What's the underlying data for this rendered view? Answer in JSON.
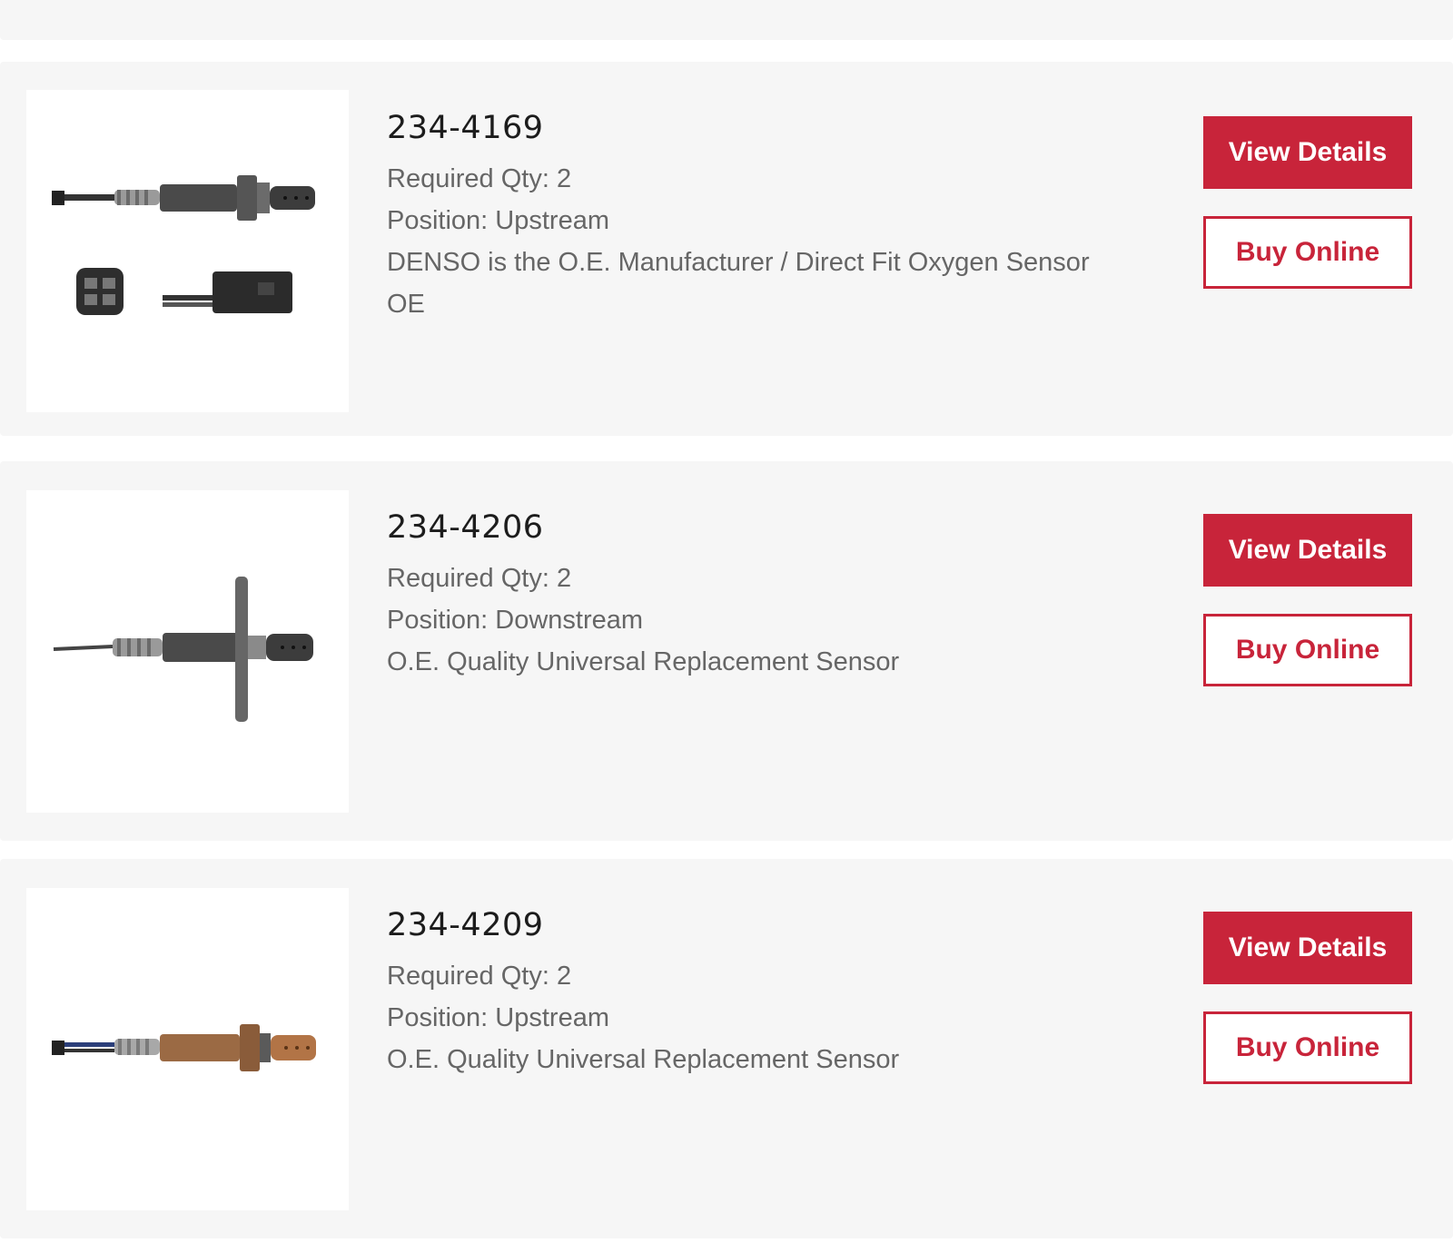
{
  "colors": {
    "accent": "#c8243a",
    "card_background": "#f6f6f6",
    "part_number_text": "#1c1c1c",
    "detail_text": "#666666"
  },
  "products": [
    {
      "part_number": "234-4169",
      "details": [
        "Required Qty: 2",
        "Position: Upstream",
        "DENSO is the O.E. Manufacturer / Direct Fit Oxygen Sensor",
        "OE"
      ],
      "image": "oxygen-sensor-with-connector",
      "view_label": "View Details",
      "buy_label": "Buy Online"
    },
    {
      "part_number": "234-4206",
      "details": [
        "Required Qty: 2",
        "Position: Downstream",
        "O.E. Quality Universal Replacement Sensor"
      ],
      "image": "oxygen-sensor-with-flange",
      "view_label": "View Details",
      "buy_label": "Buy Online"
    },
    {
      "part_number": "234-4209",
      "details": [
        "Required Qty: 2",
        "Position: Upstream",
        "O.E. Quality Universal Replacement Sensor"
      ],
      "image": "oxygen-sensor-copper",
      "view_label": "View Details",
      "buy_label": "Buy Online"
    }
  ]
}
